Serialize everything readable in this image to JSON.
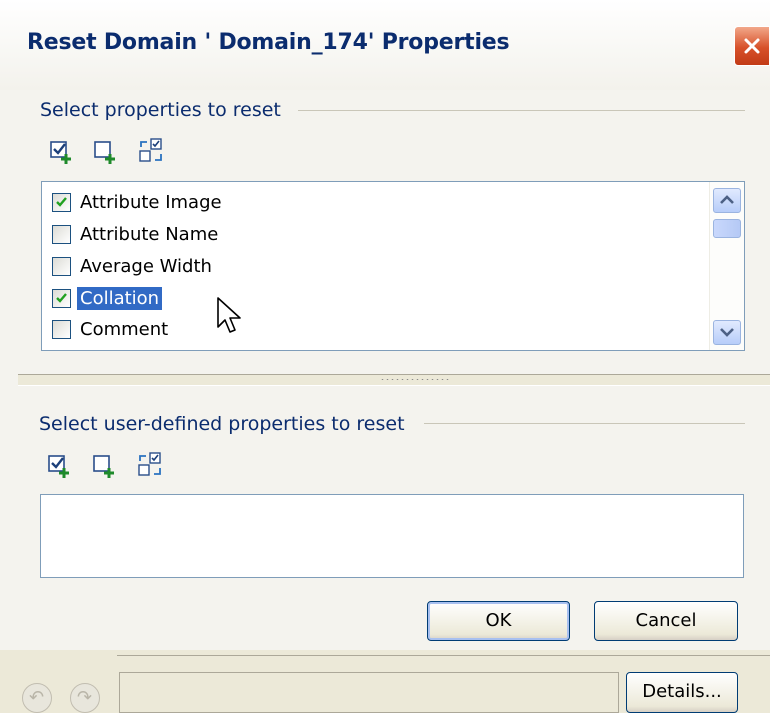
{
  "dialog": {
    "title": "Reset Domain ' Domain_174' Properties"
  },
  "section1": {
    "label": "Select properties to reset",
    "tools": [
      "check-all-icon",
      "uncheck-all-icon",
      "invert-selection-icon"
    ],
    "items": [
      {
        "label": "Attribute Image",
        "checked": true,
        "selected": false
      },
      {
        "label": "Attribute Name",
        "checked": false,
        "selected": false
      },
      {
        "label": "Average Width",
        "checked": false,
        "selected": false
      },
      {
        "label": "Collation",
        "checked": true,
        "selected": true
      },
      {
        "label": "Comment",
        "checked": false,
        "selected": false
      }
    ]
  },
  "section2": {
    "label": "Select user-defined properties to reset",
    "tools": [
      "check-all-icon",
      "uncheck-all-icon",
      "invert-selection-icon"
    ]
  },
  "buttons": {
    "ok": "OK",
    "cancel": "Cancel",
    "details": "Details..."
  },
  "colors": {
    "title_text": "#0b2c6e",
    "selection": "#316ac5",
    "close_button": "#d7512a"
  }
}
